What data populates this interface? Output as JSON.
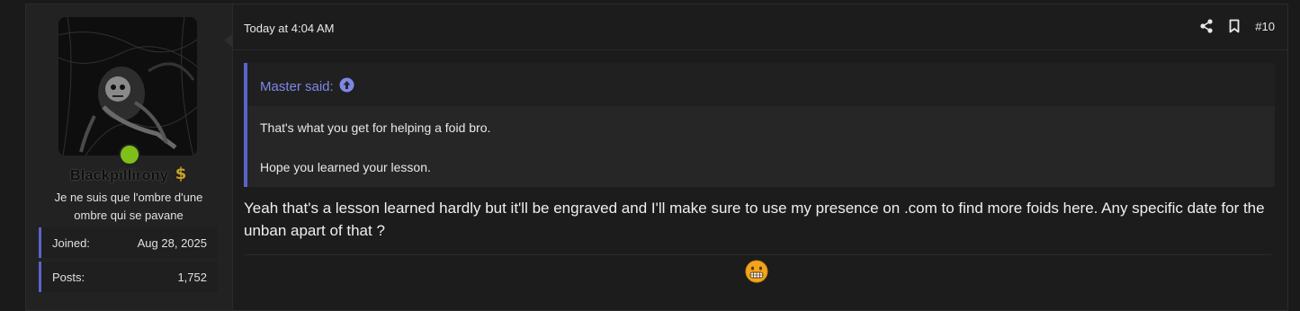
{
  "user": {
    "username": "Blackpillirony",
    "title": "Je ne suis que l'ombre d'une ombre qui se pavane",
    "stats": [
      {
        "label": "Joined:",
        "value": "Aug 28, 2025"
      },
      {
        "label": "Posts:",
        "value": "1,752"
      }
    ],
    "online": true
  },
  "post": {
    "date": "Today at 4:04 AM",
    "number": "#10",
    "icons": [
      "share-icon",
      "bookmark-icon"
    ],
    "quote": {
      "author": "Master said:",
      "lines": [
        "That's what you get for helping a foid bro.",
        "Hope you learned your lesson."
      ]
    },
    "message": "Yeah that's a lesson learned hardly but it'll be engraved and I'll make sure to use my presence on .com to find more foids here. Any specific date for the unban apart of that ?",
    "reaction": "grimace-emoji"
  },
  "colors": {
    "accent": "#5b63c9",
    "online": "#7fbf1a",
    "quote_link": "#7f87e6"
  }
}
